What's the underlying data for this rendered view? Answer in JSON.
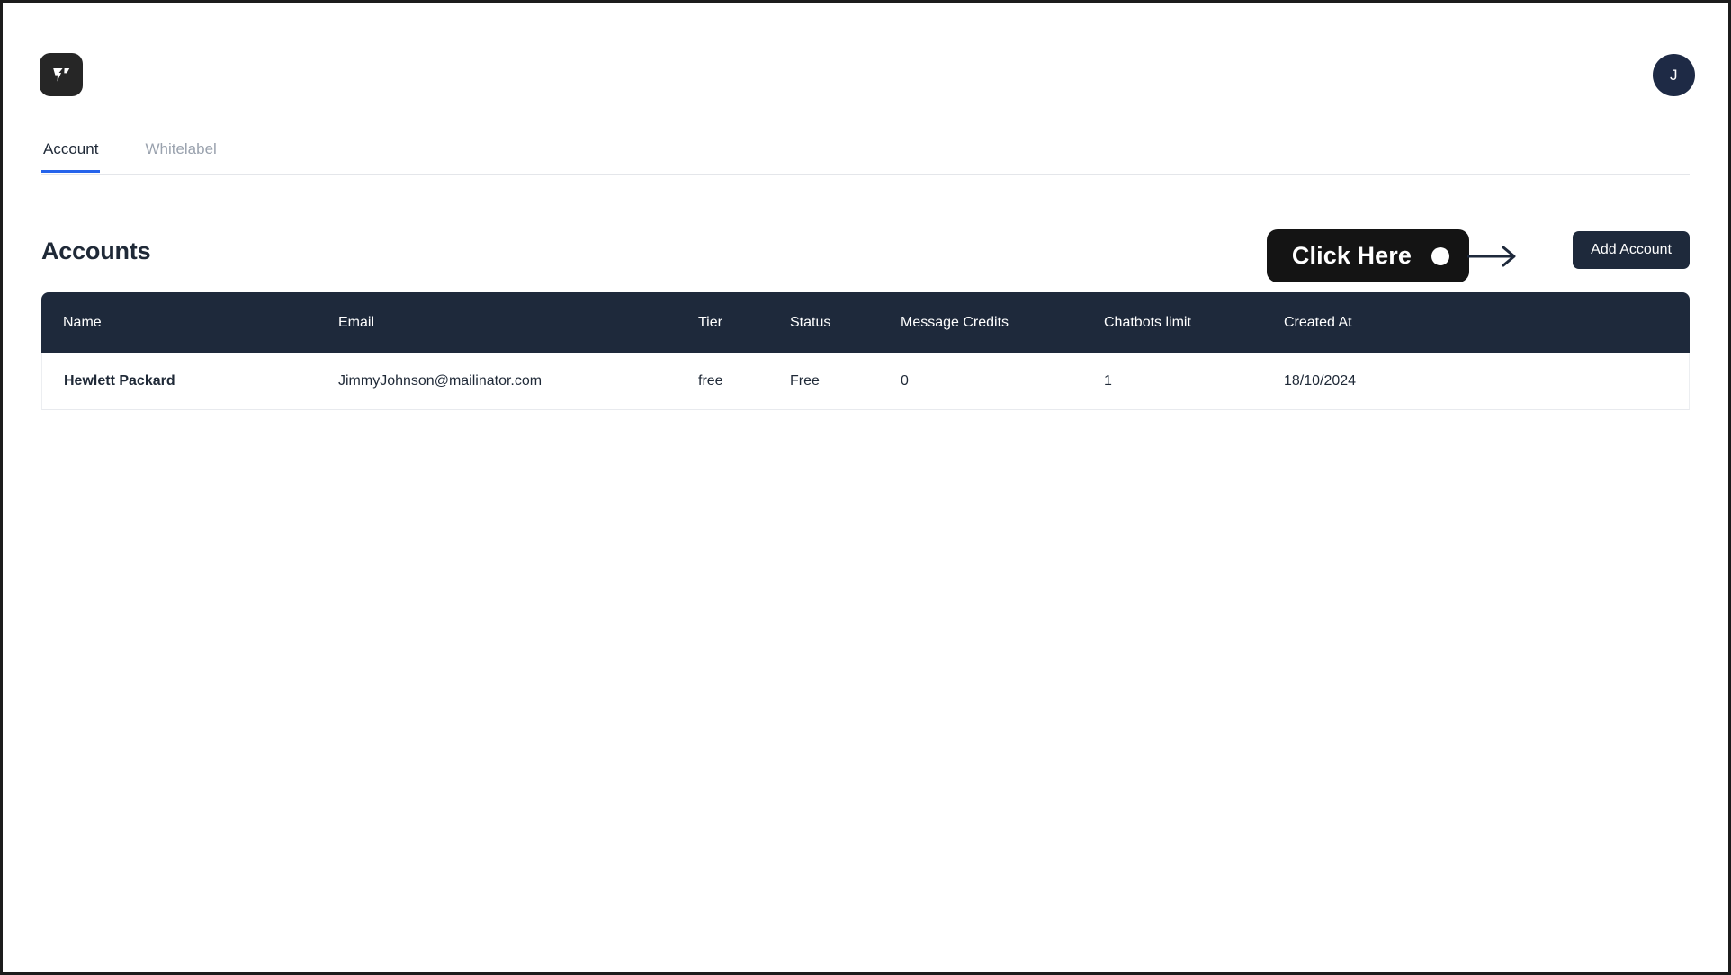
{
  "app": {
    "logo_icon": "brand-logo-icon",
    "avatar_initial": "J"
  },
  "tabs": [
    {
      "label": "Account",
      "active": true
    },
    {
      "label": "Whitelabel",
      "active": false
    }
  ],
  "page": {
    "title": "Accounts",
    "add_account_label": "Add Account"
  },
  "callout": {
    "text": "Click Here",
    "dot_icon": "cursor-dot-icon",
    "arrow_icon": "arrow-right-icon"
  },
  "table": {
    "columns": [
      "Name",
      "Email",
      "Tier",
      "Status",
      "Message Credits",
      "Chatbots limit",
      "Created At"
    ],
    "rows": [
      {
        "name": "Hewlett Packard",
        "email": "JimmyJohnson@mailinator.com",
        "tier": "free",
        "status": "Free",
        "message_credits": "0",
        "chatbots_limit": "1",
        "created_at": "18/10/2024"
      }
    ]
  },
  "colors": {
    "accent_tab": "#2563eb",
    "header_dark": "#1e293b",
    "callout_bg": "#141414",
    "logo_bg": "#262626",
    "avatar_bg": "#1e2a45"
  }
}
